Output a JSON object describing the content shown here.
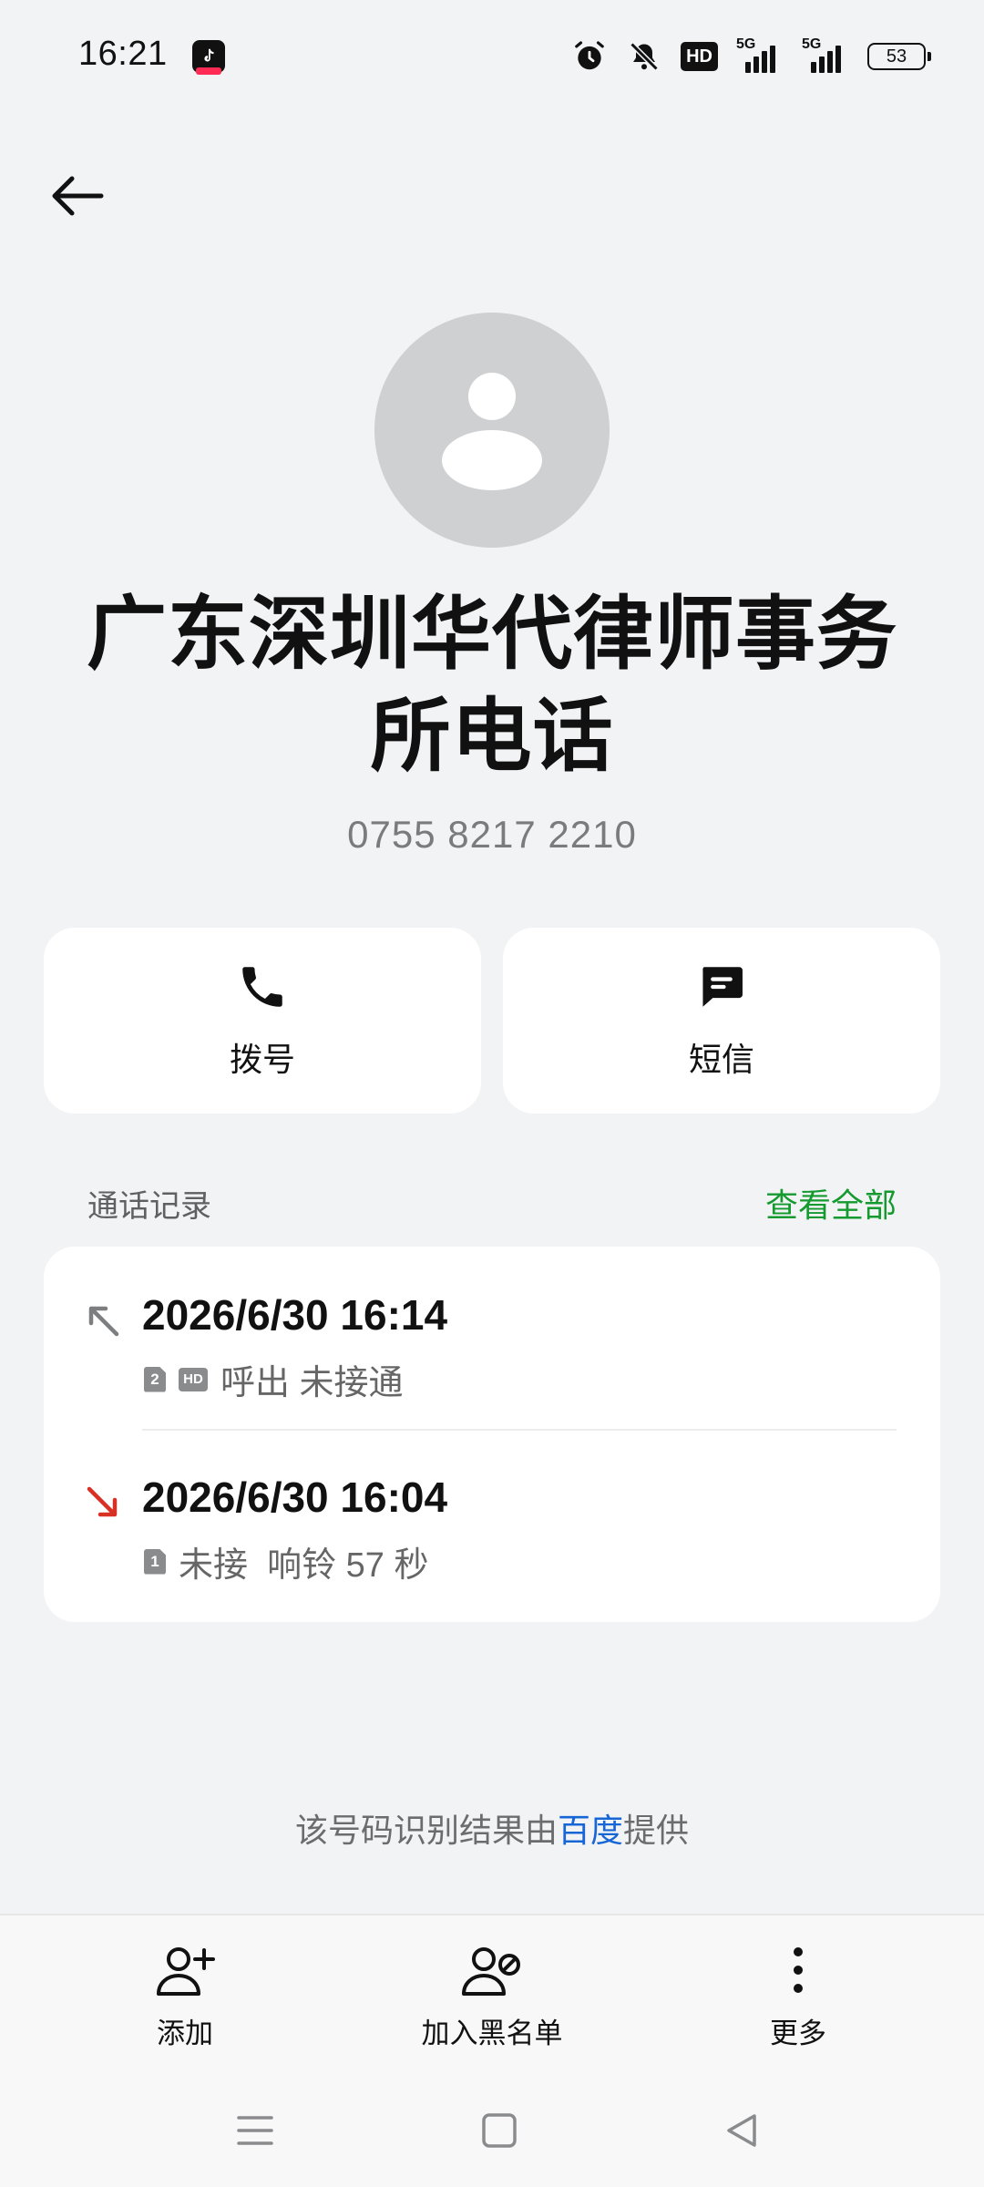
{
  "status_bar": {
    "time": "16:21",
    "network1_label": "5G",
    "network2_label": "5G",
    "hd_label": "HD",
    "battery": "53",
    "icons": [
      "tiktok-app-icon",
      "alarm-icon",
      "mute-icon",
      "hd-voice-icon",
      "signal-icon",
      "signal-icon",
      "battery-icon"
    ]
  },
  "contact": {
    "name": "广东深圳华代律师事务所电话",
    "phone": "0755 8217 2210"
  },
  "actions": {
    "dial_label": "拨号",
    "sms_label": "短信"
  },
  "call_log": {
    "title": "通话记录",
    "view_all": "查看全部",
    "entries": [
      {
        "time": "2026/6/30 16:14",
        "direction": "outgoing",
        "sim": "2",
        "hd": "HD",
        "status": "呼出 未接通"
      },
      {
        "time": "2026/6/30 16:04",
        "direction": "missed-incoming",
        "sim": "1",
        "status": "未接  响铃 57 秒"
      }
    ]
  },
  "source": {
    "prefix": "该号码识别结果由",
    "provider": "百度",
    "suffix": "提供"
  },
  "bottom_actions": {
    "add_label": "添加",
    "block_label": "加入黑名单",
    "more_label": "更多"
  },
  "colors": {
    "accent_green": "#159a2f",
    "link_blue": "#1766d6",
    "missed_red": "#d93025",
    "background": "#f2f3f5"
  }
}
